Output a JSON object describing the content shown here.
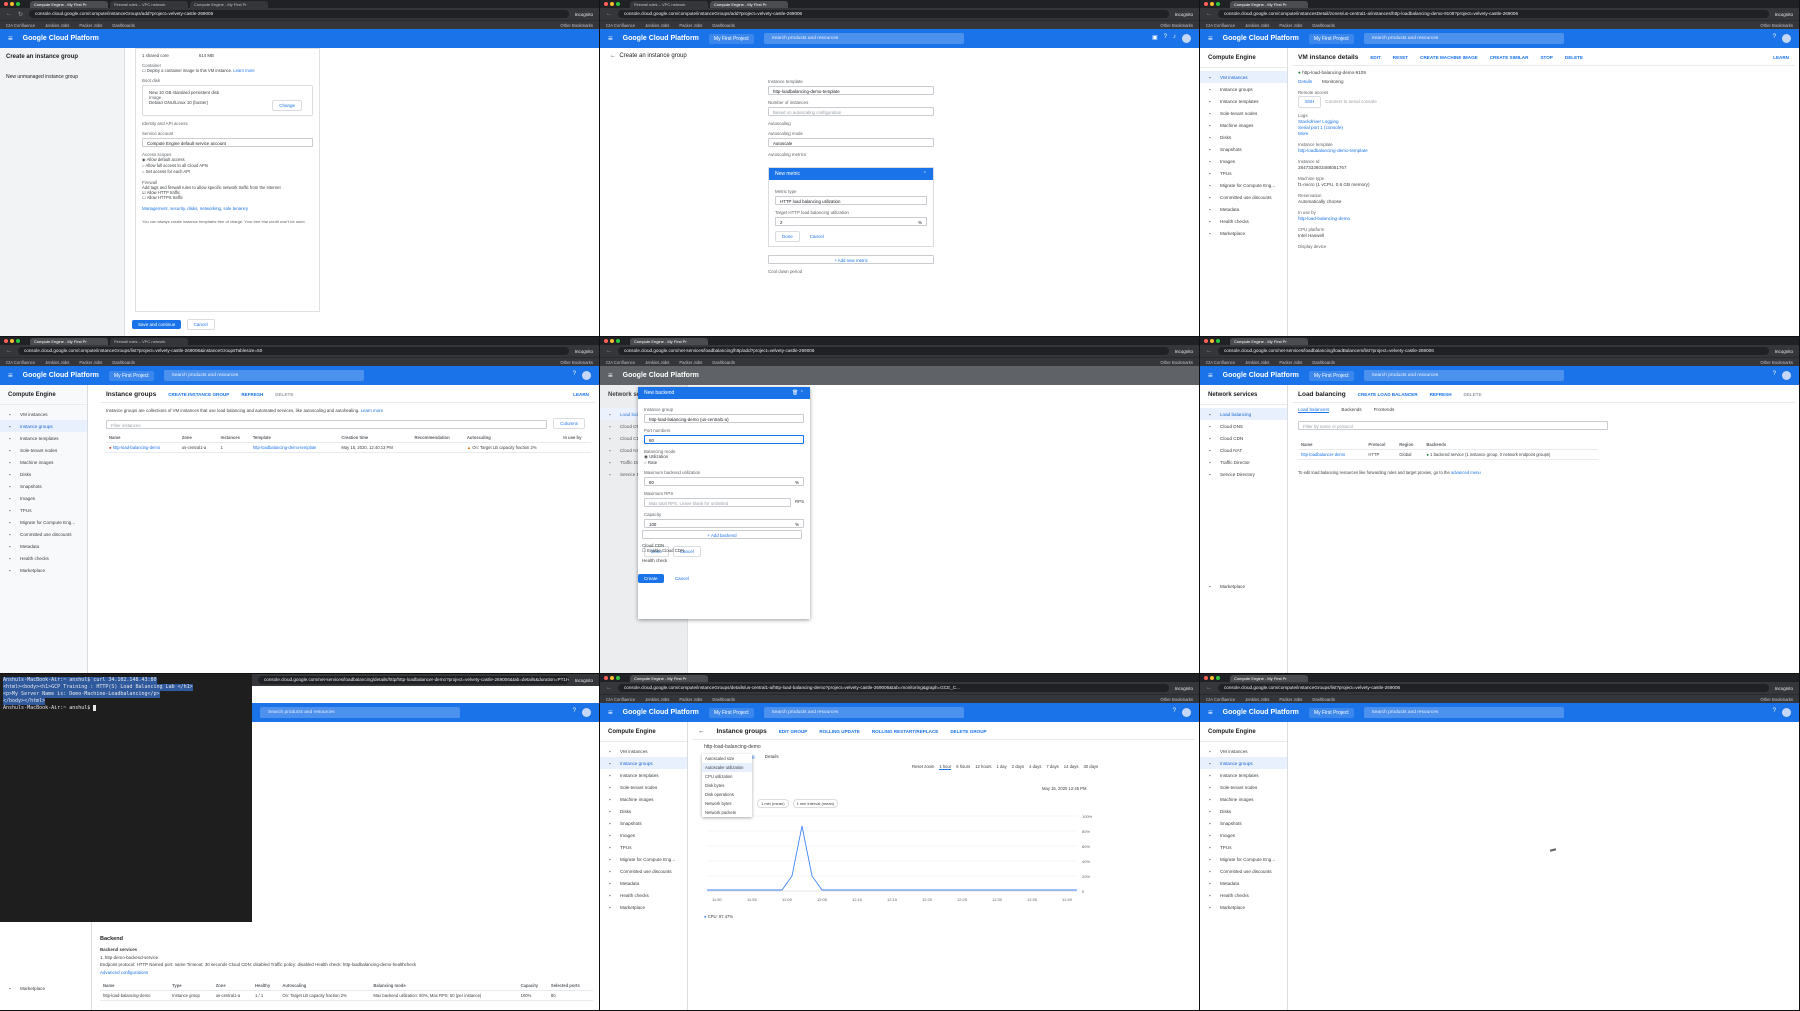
{
  "browser": {
    "tabs": [
      "Compute Engine - My First Pr",
      "Firewall rules – VPC network",
      "Compute Engine - My First Pr"
    ],
    "incognito": "Incognito",
    "bookmarks": [
      "CIA Confluence",
      "Jenkins Jobs",
      "Packer Jobs",
      "Dashboards"
    ],
    "other_bookmarks": "Other Bookmarks"
  },
  "gcp": {
    "brand": "Google Cloud Platform",
    "project": "My First Project",
    "search_placeholder": "Search products and resources"
  },
  "sidebar": {
    "compute_title": "Compute Engine",
    "compute_items": [
      "VM instances",
      "Instance groups",
      "Instance templates",
      "Sole-tenant nodes",
      "Machine images",
      "Disks",
      "Snapshots",
      "Images",
      "TPUs",
      "Migrate for Compute Eng...",
      "Committed use discounts",
      "Metadata",
      "Health checks",
      "Marketplace"
    ],
    "network_title": "Network services",
    "network_items": [
      "Load balancing",
      "Cloud DNS",
      "Cloud CDN",
      "Cloud NAT",
      "Traffic Director",
      "Service Directory",
      "Marketplace"
    ]
  },
  "panel0": {
    "url": "console.cloud.google.com/compute/instanceGroups/add?project=velvety-castle-269006",
    "title": "Create an instance group",
    "side_note_title": "New unmanaged instance group",
    "machine": "1 shared core",
    "memory": "614 MB",
    "container_label": "Container",
    "container_text": "Deploy a container image to this VM instance.",
    "learn_more": "Learn more",
    "boot_disk_label": "Boot disk",
    "boot_disk_text": "New 10 GB standard persistent disk",
    "image_label": "Image",
    "image_value": "Debian GNU/Linux 10 (buster)",
    "change": "Change",
    "identity_label": "Identity and API access",
    "service_account_label": "Service account",
    "service_account_value": "Compute Engine default service account",
    "access_scopes_label": "Access scopes",
    "scopes": [
      "Allow default access",
      "Allow full access to all Cloud APIs",
      "Set access for each API"
    ],
    "firewall_label": "Firewall",
    "firewall_text": "Add tags and firewall rules to allow specific network traffic from the Internet",
    "http": "Allow HTTP traffic",
    "https": "Allow HTTPS traffic",
    "management_link": "Management, security, disks, networking, sole tenancy",
    "footer_note": "You can always create instance templates free of charge. Your free trial credit won't be used.",
    "save": "Save and continue",
    "cancel": "Cancel"
  },
  "panel1": {
    "url": "console.cloud.google.com/compute/instanceGroups/add?project=velvety-castle-269006",
    "title": "Create an instance group",
    "template_label": "Instance template",
    "template_value": "http-loadbalancing-demo-template",
    "num_instances_label": "Number of instances",
    "num_instances_placeholder": "Based on autoscaling configuration",
    "autoscaling_label": "Autoscaling",
    "autoscaling_mode_label": "Autoscaling mode",
    "autoscaling_mode_value": "Autoscale",
    "metrics_label": "Autoscaling metrics",
    "new_metric": "New metric",
    "metric_type_label": "Metric type",
    "metric_type_value": "HTTP load balancing utilization",
    "target_label": "Target HTTP load balancing utilization",
    "target_value": "2",
    "unit": "%",
    "done": "Done",
    "cancel": "Cancel",
    "add_metric": "+ Add new metric",
    "cooldown_label": "Cool down period"
  },
  "panel2": {
    "url": "console.cloud.google.com/compute/instancesDetail/zones/us-central1-a/instances/http-loadbalancing-demo-9109?project=velvety-castle-269006",
    "title": "VM instance details",
    "actions": [
      "EDIT",
      "RESET",
      "CREATE MACHINE IMAGE",
      "CREATE SIMILAR",
      "STOP",
      "DELETE"
    ],
    "learn": "LEARN",
    "instance_name": "http-load-balancing-demo-9109",
    "tabs": [
      "Details",
      "Monitoring"
    ],
    "remote_access": "Remote access",
    "ssh": "SSH",
    "serial": "Connect to serial console",
    "logs_label": "Logs",
    "logs": [
      "Stackdriver Logging",
      "Serial port 1 (console)",
      "More"
    ],
    "template_label": "Instance template",
    "template_value": "http-loadbalancing-demo-template",
    "instance_id_label": "Instance Id",
    "instance_id": "2847333603488051767",
    "machine_type_label": "Machine type",
    "machine_type": "f1-micro (1 vCPU, 0.6 GB memory)",
    "reservation_label": "Reservation",
    "reservation": "Automatically choose",
    "in_use_label": "In use by",
    "in_use": "http-load-balancing-demo",
    "cpu_label": "CPU platform",
    "cpu": "Intel Haswell",
    "display_label": "Display device"
  },
  "panel3": {
    "url": "console.cloud.google.com/compute/instanceGroups/list?project=velvety-castle-269006&instanceGroupsTablesize=50",
    "title": "Instance groups",
    "actions": [
      "CREATE INSTANCE GROUP",
      "REFRESH",
      "DELETE"
    ],
    "learn": "LEARN",
    "description": "Instance groups are collections of VM instances that use load balancing and automated services, like autoscaling and autohealing.",
    "learn_more": "Learn more",
    "filter_placeholder": "Filter instances",
    "columns": "Columns",
    "headers": [
      "Name",
      "Zone",
      "Instances",
      "Template",
      "Creation time",
      "Recommendation",
      "Autoscaling",
      "In use by"
    ],
    "row": [
      "http-load-balancing-demo",
      "us-central1-a",
      "1",
      "http-loadbalancing-demo-template",
      "May 15, 2020, 12:40:13 PM",
      "",
      "On: Target LB capacity fraction 2%",
      ""
    ]
  },
  "panel4": {
    "url": "console.cloud.google.com/net-services/loadbalancing/http/add?project=velvety-castle-269006",
    "title": "New backend",
    "group_label": "Instance group",
    "group_value": "http-load-balancing-demo (us-central1-a)",
    "port_label": "Port numbers",
    "port_value": "80",
    "mode_label": "Balancing mode",
    "modes": [
      "Utilization",
      "Rate"
    ],
    "max_util_label": "Maximum backend utilization",
    "max_util_value": "80",
    "rps_label": "Maximum RPS",
    "rps_placeholder": "Max total RPS. Leave blank for unlimited",
    "rps_unit": "RPS",
    "capacity_label": "Capacity",
    "capacity_value": "100",
    "less": "Less",
    "done": "Done",
    "cancel": "Cancel",
    "add_backend": "+ Add backend",
    "cdn_label": "Cloud CDN",
    "cdn_text": "Enable Cloud CDN",
    "health_label": "Health check",
    "create": "Create",
    "cancel2": "Cancel"
  },
  "panel5": {
    "url": "console.cloud.google.com/net-services/loadbalancing/loadBalancers/list?project=velvety-castle-269006",
    "title": "Load balancing",
    "actions": [
      "CREATE LOAD BALANCER",
      "REFRESH",
      "DELETE"
    ],
    "tabs": [
      "Load balancers",
      "Backends",
      "Frontends"
    ],
    "filter_placeholder": "Filter by name or protocol",
    "headers": [
      "Name",
      "Protocol",
      "Region",
      "Backends"
    ],
    "row": [
      "http-loadbalancer-demo",
      "HTTP",
      "Global",
      "1 backend service (1 instance group, 0 network endpoint groups)"
    ],
    "note": "To edit load balancing resources like forwarding rules and target proxies, go to the",
    "note_link": "advanced menu"
  },
  "panel6": {
    "url": "console.cloud.google.com/net-services/loadbalancing/details/http/http-loadbalancer-demo?project=velvety-castle-269006&tab=details&duration=PT1H",
    "terminal": [
      "Anshuls-MacBook-Air:~ anshul$ curl 34.102.148.43:80",
      "<html><body><h1>GCP Training : HTTP(S) Load Balancing Lab </h1>",
      "<p>My Server Name is: Demo-Machine-Loadbalancing</p>",
      "</body></html>",
      "Anshuls-MacBook-Air:~ anshul$ "
    ],
    "backend_title": "Backend",
    "services_label": "Backend services",
    "service_name": "1. http-demo-backend-service",
    "service_meta": "Endpoint protocol: HTTP   Named port: name   Timeout: 30 seconds   Cloud CDN: disabled   Traffic policy: disabled   Health check: http-loadbalancing-demo-healthcheck",
    "advanced": "Advanced configurations",
    "headers": [
      "Name",
      "Type",
      "Zone",
      "Healthy",
      "Autoscaling",
      "Balancing mode",
      "Capacity",
      "Selected ports"
    ],
    "row": [
      "http-load-balancing-demo",
      "Instance group",
      "us-central1-a",
      "1 / 1",
      "On: Target LB capacity fraction 2%",
      "Max backend utilization: 80%, Max RPS: 50 (per instance)",
      "100%",
      "80"
    ]
  },
  "panel7": {
    "url": "console.cloud.google.com/compute/instanceGroups/details/us-central1-a/http-load-balancing-demo?project=velvety-castle-269006&tab=monitoring&graph=GCE_C...",
    "title": "Instance groups",
    "actions": [
      "EDIT GROUP",
      "ROLLING UPDATE",
      "ROLLING RESTART/REPLACE",
      "DELETE GROUP"
    ],
    "group": "http-load-balancing-demo",
    "tabs": [
      "Overview",
      "Monitoring",
      "Details"
    ],
    "dropdown": [
      "Autoscaled size",
      "Autoscaler utilization",
      "CPU utilization",
      "Disk bytes",
      "Disk operations",
      "Network bytes",
      "Network packets"
    ],
    "zoom_label": "Reset zoom",
    "ranges": [
      "1 hour",
      "6 hours",
      "12 hours",
      "1 day",
      "2 days",
      "4 days",
      "7 days",
      "14 days",
      "30 days"
    ],
    "chips": [
      "1 min (mean)",
      "1 min interval (mean)"
    ],
    "date": "May 15, 2020 12:45 PM",
    "legend": "CPU: 97.47%",
    "yticks": [
      "100%",
      "80%",
      "60%",
      "40%",
      "20%",
      "0"
    ],
    "xticks": [
      "11:50",
      "11:55",
      "12:00",
      "12:05",
      "12:10",
      "12:15",
      "12:20",
      "12:25",
      "12:30",
      "12:35",
      "12:40"
    ]
  },
  "panel8": {
    "url": "console.cloud.google.com/compute/instanceGroups/list?project=velvety-castle-269006"
  }
}
